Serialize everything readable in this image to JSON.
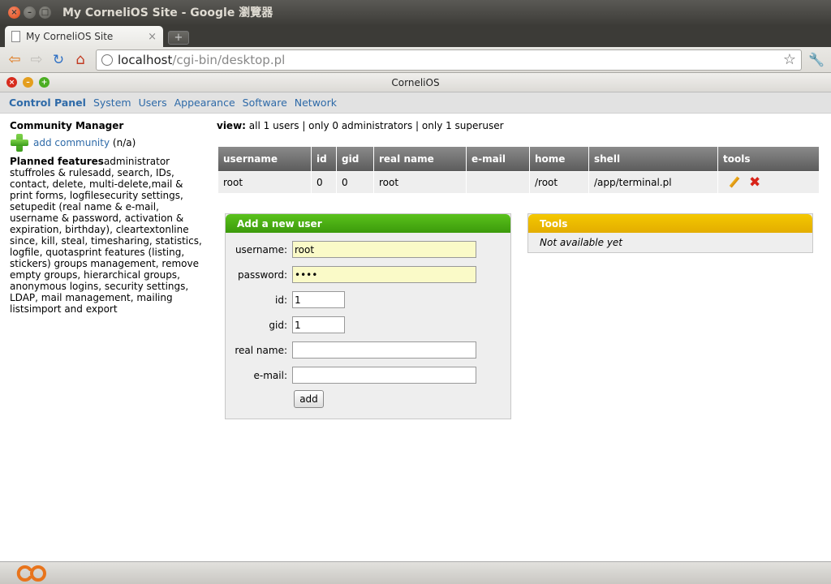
{
  "window": {
    "title": "My CorneliOS Site - Google 瀏覽器"
  },
  "browser": {
    "tab_title": "My CorneliOS Site",
    "tab_close": "×",
    "new_tab": "+",
    "url_host": "localhost",
    "url_path": "/cgi-bin/desktop.pl"
  },
  "app": {
    "title": "CorneliOS"
  },
  "menu": {
    "items": [
      "Control Panel",
      "System",
      "Users",
      "Appearance",
      "Software",
      "Network"
    ]
  },
  "sidebar": {
    "heading": "Community Manager",
    "add_community": "add community",
    "add_community_note": "(n/a)",
    "planned_label": "Planned features",
    "planned_text": "administrator stuffroles & rulesadd, search, IDs, contact, delete, multi-delete,mail & print forms, logfilesecurity settings, setupedit (real name & e-mail, username & password, activation & expiration, birthday), cleartextonline since, kill, steal, timesharing, statistics, logfile, quotasprint features (listing, stickers) groups management, remove empty groups, hierarchical groups, anonymous logins, security settings, LDAP, mail management, mailing listsimport and export"
  },
  "main": {
    "view_label": "view:",
    "view_options": "all 1 users | only 0 administrators | only 1 superuser",
    "table": {
      "headers": [
        "username",
        "id",
        "gid",
        "real name",
        "e-mail",
        "home",
        "shell",
        "tools"
      ],
      "rows": [
        {
          "username": "root",
          "id": "0",
          "gid": "0",
          "real_name": "root",
          "email": "",
          "home": "/root",
          "shell": "/app/terminal.pl"
        }
      ]
    }
  },
  "add_user": {
    "heading": "Add a new user",
    "username_label": "username:",
    "username_value": "root",
    "password_label": "password:",
    "password_value": "root",
    "id_label": "id:",
    "id_value": "1",
    "gid_label": "gid:",
    "gid_value": "1",
    "realname_label": "real name:",
    "realname_value": "",
    "email_label": "e-mail:",
    "email_value": "",
    "add_button": "add"
  },
  "tools_panel": {
    "heading": "Tools",
    "body": "Not available yet"
  },
  "colors": {
    "accent_link": "#2e6aa8",
    "panel_green": "#4aab12",
    "panel_yellow": "#f0bd00",
    "delete_red": "#d8241a"
  }
}
